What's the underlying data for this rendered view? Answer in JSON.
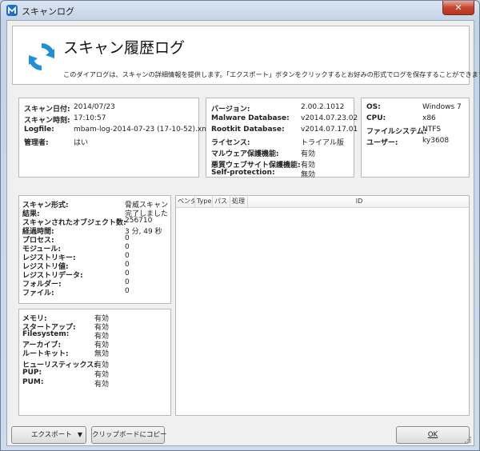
{
  "window": {
    "title": "スキャンログ",
    "close_symbol": "✕",
    "app_icon": "malwarebytes-logo-icon"
  },
  "header": {
    "title": "スキャン履歴ログ",
    "description": "このダイアログは、スキャンの詳細情報を提供します。「エクスポート」ボタンをクリックするとお好みの形式でログを保存することができます。",
    "icon": "refresh-arrows-icon"
  },
  "scan_info": [
    {
      "label": "スキャン日付:",
      "value": "2014/07/23"
    },
    {
      "label": "スキャン時刻:",
      "value": "17:10:57"
    },
    {
      "label": "Logfile:",
      "value": "mbam-log-2014-07-23 (17-10-52).xml"
    },
    {
      "label": "管理者:",
      "value": "はい"
    }
  ],
  "version_info": [
    {
      "label": "バージョン:",
      "value": "2.00.2.1012"
    },
    {
      "label": "Malware Database:",
      "value": "v2014.07.23.02"
    },
    {
      "label": "Rootkit Database:",
      "value": "v2014.07.17.01"
    },
    {
      "label": "ライセンス:",
      "value": "トライアル版"
    },
    {
      "label": "マルウェア保護機能:",
      "value": "有効"
    },
    {
      "label": "悪質ウェブサイト保護機能:",
      "value": "有効"
    },
    {
      "label": "Self-protection:",
      "value": "無効"
    }
  ],
  "system_info": [
    {
      "label": "OS:",
      "value": "Windows 7"
    },
    {
      "label": "CPU:",
      "value": "x86"
    },
    {
      "label": "ファイルシステム:",
      "value": "NTFS"
    },
    {
      "label": "ユーザー:",
      "value": "ky3608"
    }
  ],
  "scan_stats": [
    {
      "label": "スキャン形式:",
      "value": "脅威スキャン"
    },
    {
      "label": "結果:",
      "value": "完了しました"
    },
    {
      "label": "スキャンされたオブジェクト数:",
      "value": "256710"
    },
    {
      "label": "経過時間:",
      "value": "3 分, 49 秒"
    },
    {
      "label": "プロセス:",
      "value": "0"
    },
    {
      "label": "モジュール:",
      "value": "0"
    },
    {
      "label": "レジストリキー:",
      "value": "0"
    },
    {
      "label": "レジストリ値:",
      "value": "0"
    },
    {
      "label": "レジストリデータ:",
      "value": "0"
    },
    {
      "label": "フォルダー:",
      "value": "0"
    },
    {
      "label": "ファイル:",
      "value": "0"
    }
  ],
  "scan_options": [
    {
      "label": "メモリ:",
      "value": "有効"
    },
    {
      "label": "スタートアップ:",
      "value": "有効"
    },
    {
      "label": "Filesystem:",
      "value": "有効"
    },
    {
      "label": "アーカイブ:",
      "value": "有効"
    },
    {
      "label": "ルートキット:",
      "value": "無効"
    },
    {
      "label": "ヒューリスティックス:",
      "value": "有効"
    },
    {
      "label": "PUP:",
      "value": "有効"
    },
    {
      "label": "PUM:",
      "value": "有効"
    }
  ],
  "table": {
    "columns": [
      "ベンダー",
      "Type",
      "パス",
      "処理",
      "ID"
    ]
  },
  "buttons": {
    "export": "エクスポート",
    "export_caret": "▼",
    "copy": "クリップボードにコピー",
    "ok": "OK"
  }
}
